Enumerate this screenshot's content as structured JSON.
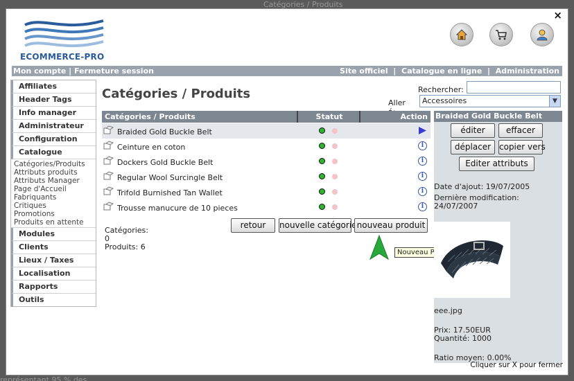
{
  "modal": {
    "close_label": "×",
    "footer": "Cliquer sur X pour fermer"
  },
  "logo": {
    "text": "ECOMMERCE-PRO"
  },
  "header_icons": [
    "home-icon",
    "cart-icon",
    "user-icon"
  ],
  "topbar": {
    "left": [
      "Mon compte",
      "Fermeture session"
    ],
    "right": [
      "Site officiel",
      "Catalogue en ligne",
      "Administration"
    ],
    "separator": "|"
  },
  "sidebar": {
    "sections": [
      {
        "label": "Affiliates"
      },
      {
        "label": "Header Tags"
      },
      {
        "label": "Info manager"
      },
      {
        "label": "Administrateur"
      },
      {
        "label": "Configuration"
      },
      {
        "label": "Catalogue",
        "items": [
          "Catégories/Produits",
          "Attributs produits",
          "Attributs Manager",
          "Page d'Accueil",
          "Fabriquants",
          "Critiques",
          "Promotions",
          "Produits en attente"
        ]
      },
      {
        "label": "Modules"
      },
      {
        "label": "Clients"
      },
      {
        "label": "Lieux / Taxes"
      },
      {
        "label": "Localisation"
      },
      {
        "label": "Rapports"
      },
      {
        "label": "Outils"
      }
    ]
  },
  "main": {
    "title": "Catégories / Produits",
    "search_label": "Rechercher:",
    "search_value": "",
    "goto_label": "Aller á:",
    "goto_value": "Accessoires",
    "table_headers": {
      "name": "Catégories / Produits",
      "status": "Statut",
      "action": "Action"
    },
    "rows": [
      {
        "name": "Braided Gold Buckle Belt",
        "selected": true,
        "action": "arrow-right-icon"
      },
      {
        "name": "Ceinture en coton",
        "action": "info-icon"
      },
      {
        "name": "Dockers Gold Buckle Belt",
        "action": "info-icon"
      },
      {
        "name": "Regular Wool Surcingle Belt",
        "action": "info-icon"
      },
      {
        "name": "Trifold Burnished Tan Wallet",
        "action": "info-icon"
      },
      {
        "name": "Trousse manucure de 10 pieces",
        "action": "info-icon"
      }
    ],
    "counts": {
      "categories": "Catégories: 0",
      "products": "Produits: 6"
    },
    "buttons": {
      "back": "retour",
      "new_category": "nouvelle catégorie",
      "new_product": "nouveau produit"
    },
    "tooltip": "Nouveau Produit"
  },
  "panel": {
    "title": "Braided Gold Buckle Belt",
    "buttons": {
      "edit": "éditer",
      "delete": "effacer",
      "move": "déplacer",
      "copy": "copier vers",
      "attributes": "Editer attributs"
    },
    "date_added": "Date d'ajout: 19/07/2005",
    "last_modified_label": "Dernière modification:",
    "last_modified_date": "24/07/2007",
    "image_name": "eee.jpg",
    "price": "Prix: 17.50EUR",
    "quantity": "Quantité: 1000",
    "rating": "Ratio moyen: 0.00%"
  },
  "colors": {
    "header_bar": "#9aa3ad",
    "table_head": "#7d8792",
    "logo_blue": "#2a5b9a",
    "status_green": "#2db52d",
    "status_red": "#f4c3c6",
    "accent_arrow": "#22aa33"
  }
}
